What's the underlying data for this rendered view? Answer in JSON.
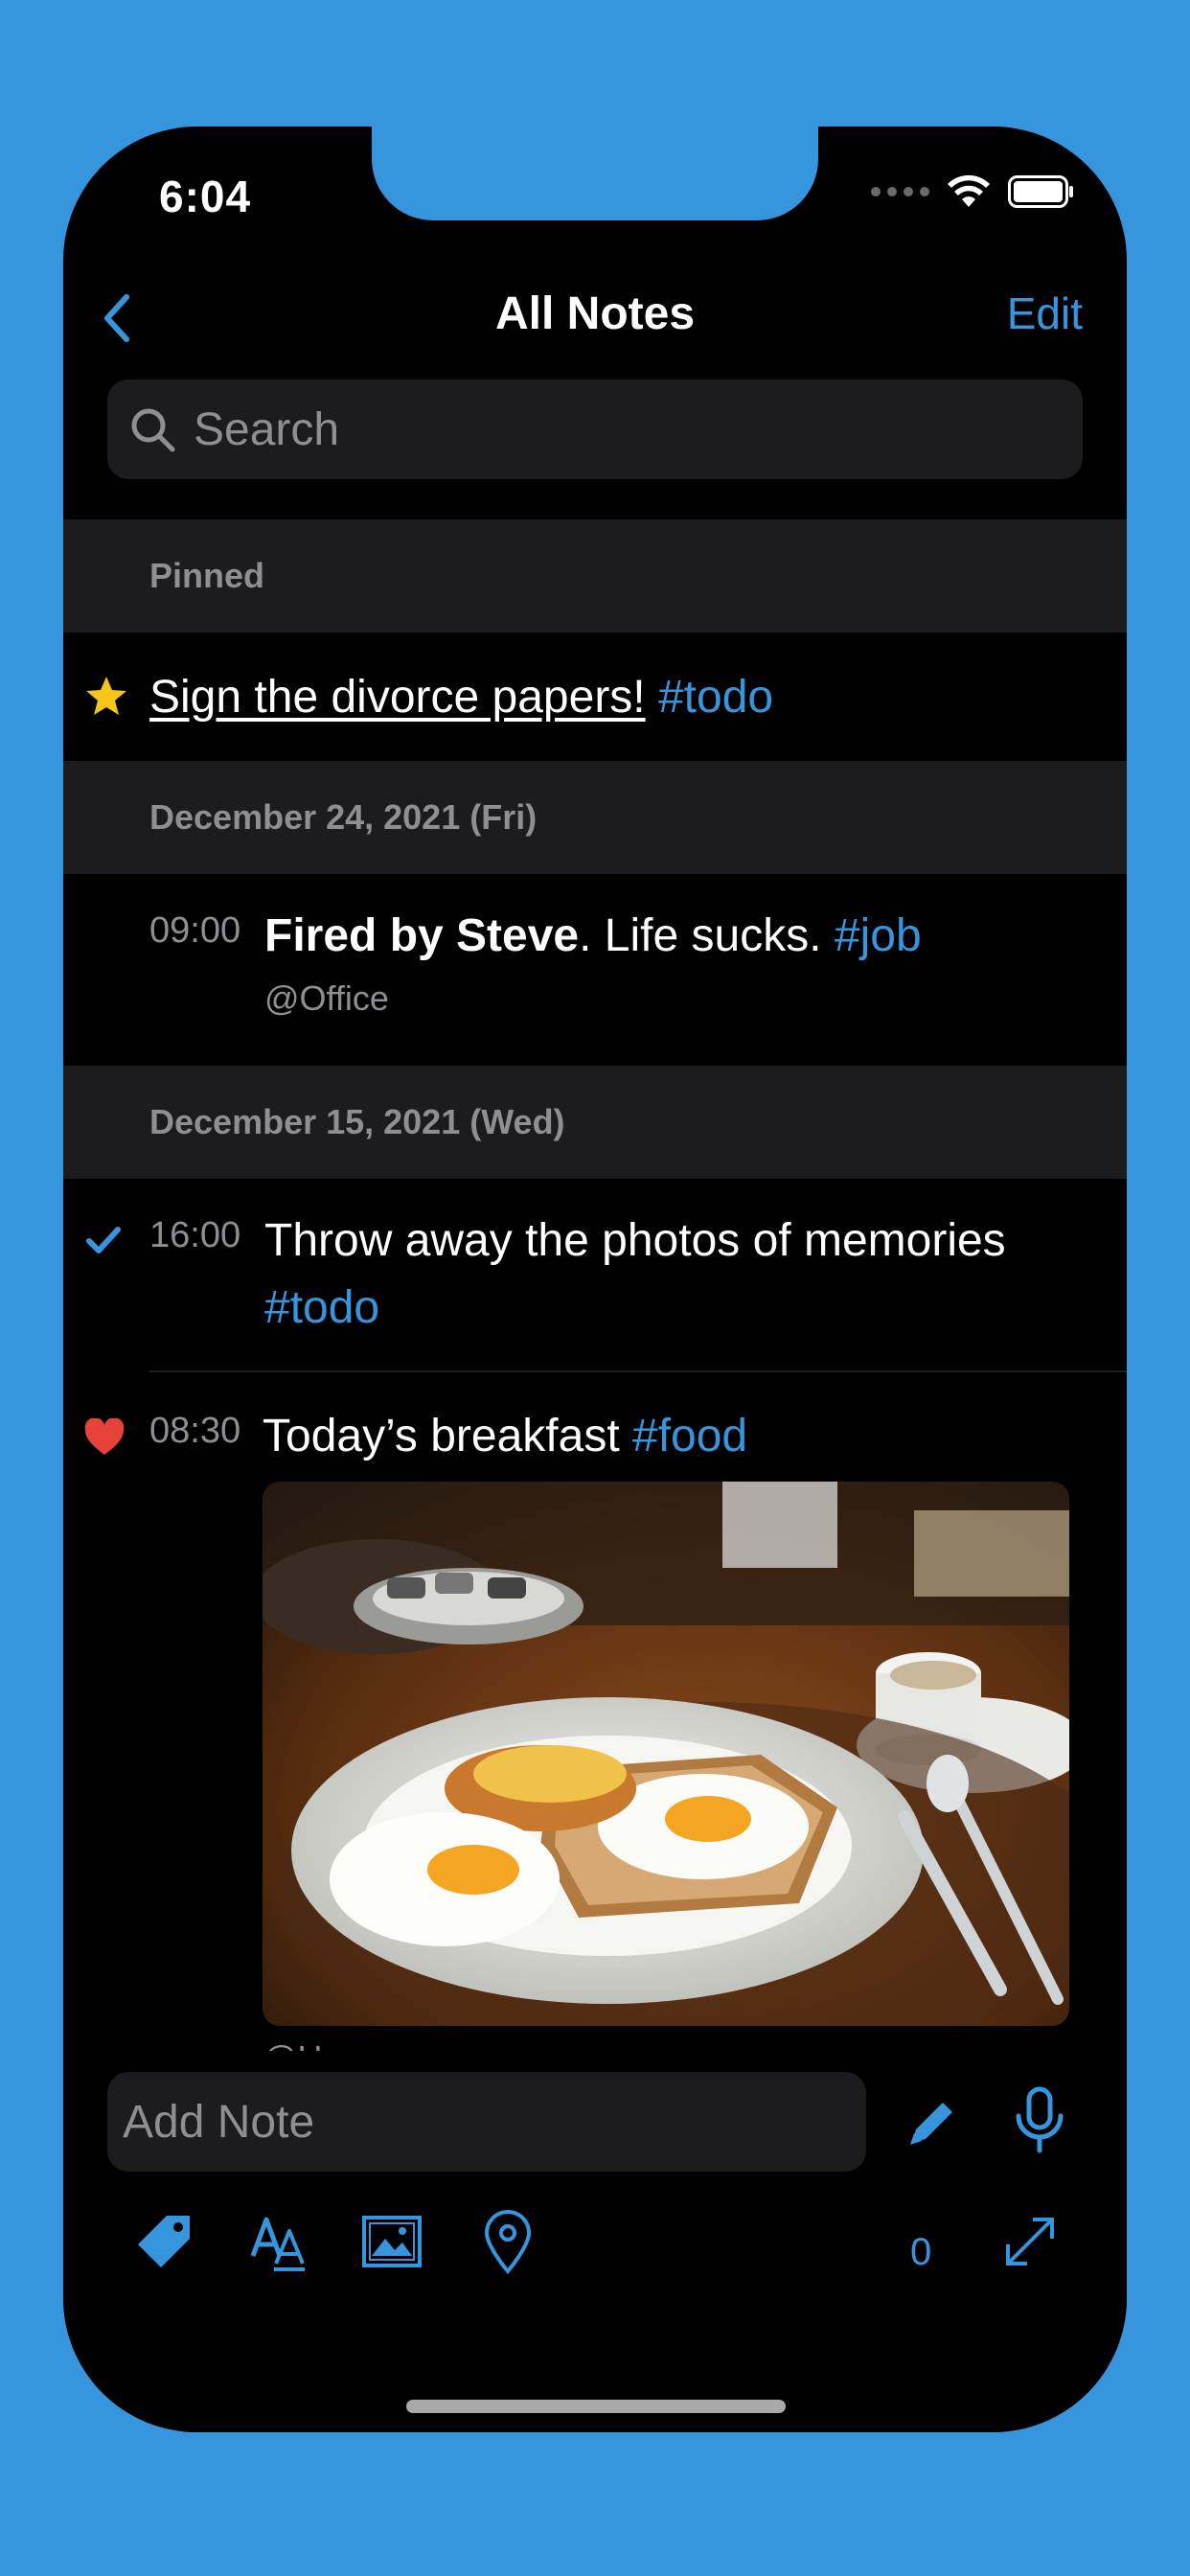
{
  "status_bar": {
    "time": "6:04"
  },
  "nav": {
    "title": "All Notes",
    "edit_label": "Edit"
  },
  "search": {
    "placeholder": "Search"
  },
  "sections": {
    "pinned": {
      "header": "Pinned",
      "note": {
        "text": "Sign the divorce papers!",
        "tag": "#todo"
      }
    },
    "dec24": {
      "header": "December 24, 2021 (Fri)",
      "entry": {
        "time": "09:00",
        "bold": "Fired by Steve",
        "text": ". Life sucks. ",
        "tag": "#job",
        "location": "@Office"
      }
    },
    "dec15": {
      "header": "December 15, 2021 (Wed)",
      "entries": [
        {
          "time": "16:00",
          "text": "Throw away the photos of memories ",
          "tag": "#todo",
          "status_icon": "checkmark-icon"
        },
        {
          "time": "08:30",
          "text": "Today’s breakfast ",
          "tag": "#food",
          "status_icon": "heart-icon",
          "location": "@Home"
        }
      ]
    }
  },
  "composer": {
    "placeholder": "Add Note",
    "count": "0"
  },
  "colors": {
    "accent": "#3695DD",
    "background": "#000000",
    "section": "#1C1C1E",
    "star": "#F5C518",
    "heart": "#E5433A"
  }
}
